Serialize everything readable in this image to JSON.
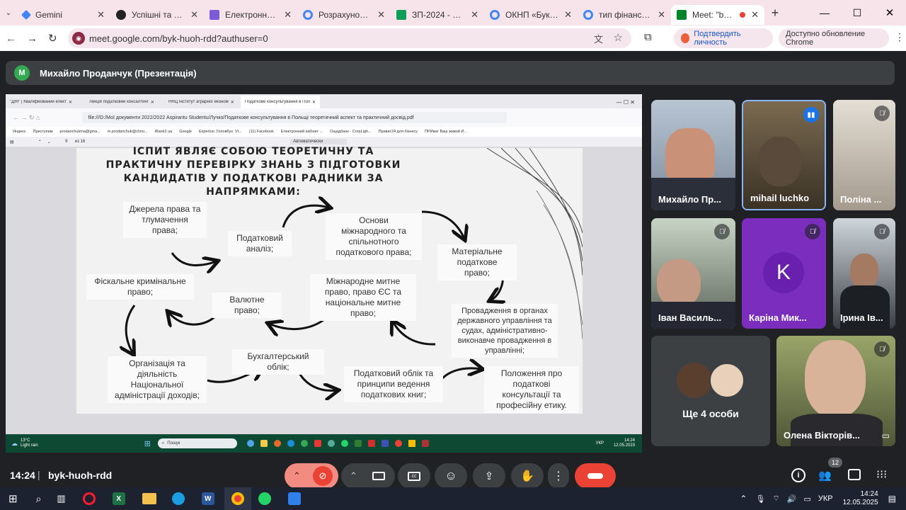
{
  "browser": {
    "tabs": [
      {
        "title": "Gemini",
        "color": "#4285f4"
      },
      {
        "title": "Успішні та пров",
        "color": "#222222"
      },
      {
        "title": "Електронний ка",
        "color": "#7b5cd6"
      },
      {
        "title": "Розрахунок пок",
        "color": "#4285f4"
      },
      {
        "title": "ЗП-2024 - Goog",
        "color": "#0f9d58"
      },
      {
        "title": "ОКНП «Буковин",
        "color": "#4285f4"
      },
      {
        "title": "тип фінансуван",
        "color": "#4285f4"
      },
      {
        "title": "Meet: \"byk-h",
        "color": "#00832d"
      }
    ],
    "url": "meet.google.com/byk-huoh-rdd?authuser=0",
    "verify_label": "Подтвердить личность",
    "update_label": "Доступно обновление Chrome"
  },
  "presenter": {
    "initial": "М",
    "label": "Михайло Проданчук (Презентація)"
  },
  "shared": {
    "tabs": [
      "\"ДІЯ\" | Кваліфікований елект",
      "Лекція податковий консалтинг",
      "ННЦ Інститут аграрної економ",
      "Податкове консультування в Польщі"
    ],
    "url": "file:///D:/Мої документи 2022/2022 Aspirantu Studentu/Лучко/Податкове консультування в Польщі теоретичний аспект та практичний досвід.pdf",
    "bookmarks": [
      "Яндекс",
      "Приступим",
      "prodanchukma@gma...",
      "m.prodanchuk@chnu...",
      "iBank2 ua",
      "Google",
      "Expertus: Головбух. Vt...",
      "(11) Facebook",
      "Електронний кабінет ...",
      "Ощадбанк - CorpLigh...",
      "Приват24 для бізнесу",
      "ПРИват Ваш живой И..."
    ],
    "page_num": "9",
    "page_of": "из 16",
    "zoom": "Автоматически",
    "slide": {
      "title": "ІСПИТ ЯВЛЯЄ СОБОЮ ТЕОРЕТИЧНУ ТА ПРАКТИЧНУ ПЕРЕВІРКУ ЗНАНЬ З ПІДГОТОВКИ КАНДИДАТІВ У ПОДАТКОВІ РАДНИКИ ЗА НАПРЯМКАМИ:",
      "nodes": [
        "Джерела права та тлумачення права;",
        "Податковий аналіз;",
        "Основи міжнародного та спільнотного податкового права;",
        "Матеріальне податкове право;",
        "Фіскальне кримінальне право;",
        "Валютне право;",
        "Міжнародне митне право, право ЄС та національне митне право;",
        "Провадження в органах державного управління та судах, адміністративно-виконавче провадження в управлінні;",
        "Організація та діяльність Національної адміністрації доходів;",
        "Бухгалтерський облік;",
        "Податковий облік та принципи ведення податкових книг;",
        "Положення про податкові консультації та професійну етику."
      ]
    },
    "taskbar": {
      "weather": "13°C",
      "weather_desc": "Light rain",
      "search": "Пошук",
      "lang": "УКР",
      "time": "14:24",
      "date": "12.05.2023"
    }
  },
  "participants": [
    {
      "name": "Михайло Пр...",
      "muted": false
    },
    {
      "name": "mihail luchko",
      "muted": false,
      "speaking": true
    },
    {
      "name": "Поліна ...",
      "muted": true
    },
    {
      "name": "Іван Василь...",
      "muted": true
    },
    {
      "name": "Каріна Мик...",
      "muted": true,
      "initial": "K"
    },
    {
      "name": "Ірина Ів...",
      "muted": true
    },
    {
      "name": "Олена Вікторів...",
      "muted": true
    }
  ],
  "others": {
    "label": "Ще 4 особи"
  },
  "meeting": {
    "time": "14:24",
    "code": "byk-huoh-rdd",
    "people_count": "12"
  },
  "windows_taskbar": {
    "lang": "УКР",
    "time": "14:24",
    "date": "12.05.2025"
  }
}
